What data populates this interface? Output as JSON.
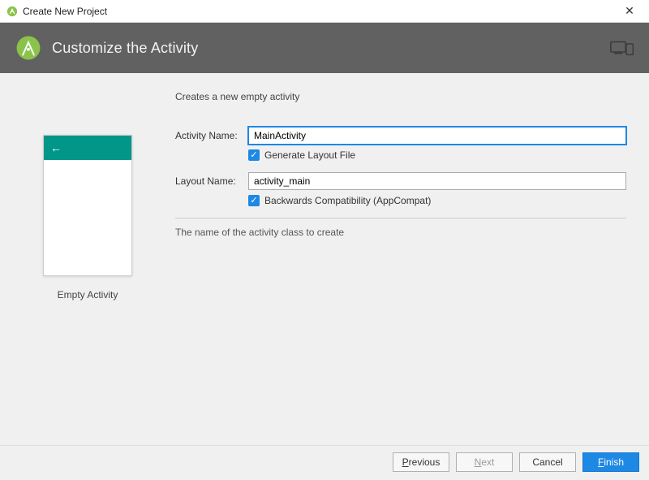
{
  "window": {
    "title": "Create New Project",
    "close_glyph": "✕"
  },
  "header": {
    "heading": "Customize the Activity"
  },
  "preview": {
    "back_glyph": "←",
    "label": "Empty Activity"
  },
  "form": {
    "description": "Creates a new empty activity",
    "activity_name_label": "Activity Name:",
    "activity_name_value": "MainActivity",
    "generate_layout_label": "Generate Layout File",
    "layout_name_label": "Layout Name:",
    "layout_name_value": "activity_main",
    "appcompat_label": "Backwards Compatibility (AppCompat)",
    "help_text": "The name of the activity class to create",
    "check_glyph": "✓"
  },
  "footer": {
    "previous": "Previous",
    "previous_mnemonic": "P",
    "next": "Next",
    "next_mnemonic": "N",
    "cancel": "Cancel",
    "finish": "Finish",
    "finish_mnemonic": "F"
  }
}
